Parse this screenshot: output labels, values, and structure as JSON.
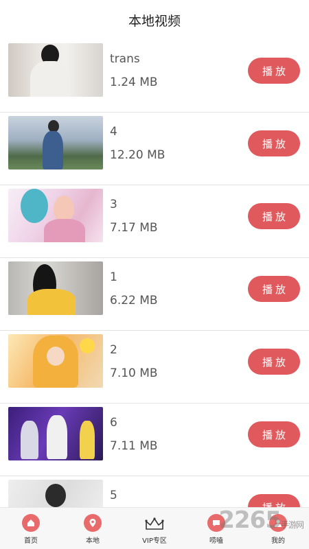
{
  "header": {
    "title": "本地视频"
  },
  "videos": [
    {
      "title": "trans",
      "size": "1.24 MB",
      "play_label": "播放"
    },
    {
      "title": "4",
      "size": "12.20 MB",
      "play_label": "播放"
    },
    {
      "title": "3",
      "size": "7.17 MB",
      "play_label": "播放"
    },
    {
      "title": "1",
      "size": "6.22 MB",
      "play_label": "播放"
    },
    {
      "title": "2",
      "size": "7.10 MB",
      "play_label": "播放"
    },
    {
      "title": "6",
      "size": "7.11 MB",
      "play_label": "播放"
    },
    {
      "title": "5",
      "size": "",
      "play_label": "播放"
    }
  ],
  "tabbar": {
    "items": [
      {
        "label": "首页",
        "icon": "home-icon"
      },
      {
        "label": "本地",
        "icon": "location-icon"
      },
      {
        "label": "VIP专区",
        "icon": "crown-icon"
      },
      {
        "label": "唠嗑",
        "icon": "chat-icon"
      },
      {
        "label": "我的",
        "icon": "profile-icon"
      }
    ]
  },
  "watermark": {
    "text": "2265",
    "sub": "手游网"
  },
  "colors": {
    "accent": "#e05a5d",
    "tab_icon": "#e86a6a"
  }
}
